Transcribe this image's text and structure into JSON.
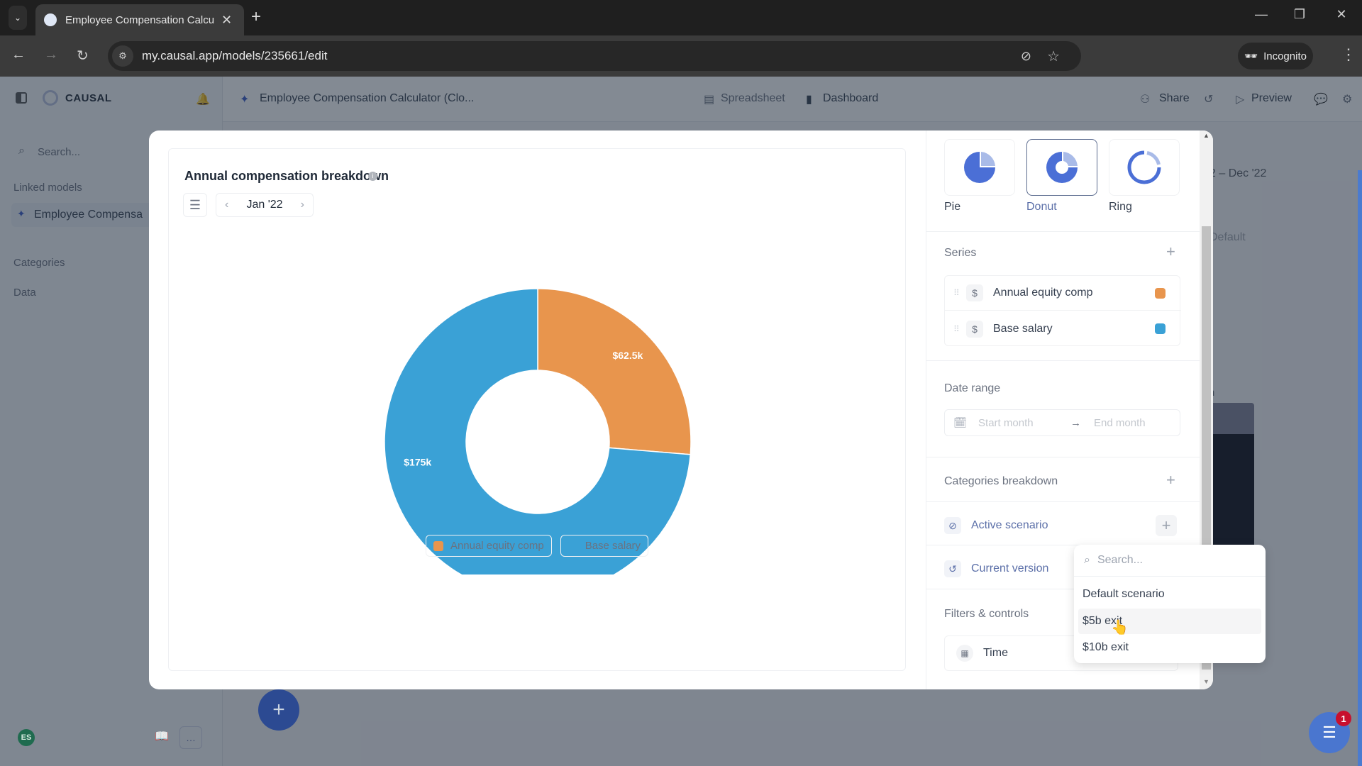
{
  "browser": {
    "tab_title": "Employee Compensation Calcul",
    "url": "my.causal.app/models/235661/edit",
    "incognito_label": "Incognito"
  },
  "app": {
    "brand": "CAUSAL",
    "sidebar": {
      "search_placeholder": "Search...",
      "linked_models_label": "Linked models",
      "linked_model": "Employee Compensa",
      "categories_label": "Categories",
      "data_label": "Data",
      "avatar_initials": "ES"
    },
    "header": {
      "model_title": "Employee Compensation Calculator (Clo...",
      "tabs": [
        {
          "label": "Spreadsheet"
        },
        {
          "label": "Dashboard"
        }
      ],
      "share_label": "Share",
      "preview_label": "Preview"
    },
    "background": {
      "date_range": "2 – Dec '22",
      "scenario": "Default",
      "partial_heading": "n"
    },
    "support_badge": "1"
  },
  "modal": {
    "chart_title": "Annual compensation breakdown",
    "period": "Jan '22",
    "chart_types": [
      {
        "label": "Pie",
        "selected": false
      },
      {
        "label": "Donut",
        "selected": true
      },
      {
        "label": "Ring",
        "selected": false
      }
    ],
    "series_title": "Series",
    "series": [
      {
        "name": "Annual equity comp",
        "color": "#e8954d"
      },
      {
        "name": "Base salary",
        "color": "#3aa1d6"
      }
    ],
    "date_range_title": "Date range",
    "start_placeholder": "Start month",
    "end_placeholder": "End month",
    "categories_breakdown_title": "Categories breakdown",
    "active_scenario_label": "Active scenario",
    "current_version_label": "Current version",
    "filters_title": "Filters & controls",
    "time_label": "Time"
  },
  "dropdown": {
    "search_placeholder": "Search...",
    "items": [
      {
        "label": "Default scenario",
        "hovered": false
      },
      {
        "label": "$5b exit",
        "hovered": true
      },
      {
        "label": "$10b exit",
        "hovered": false
      }
    ]
  },
  "chart_data": {
    "type": "pie",
    "variant": "donut",
    "title": "Annual compensation breakdown",
    "period": "Jan '22",
    "categories": [
      "Annual equity comp",
      "Base salary"
    ],
    "values": [
      62500,
      175000
    ],
    "labels": [
      "$62.5k",
      "$175k"
    ],
    "colors": [
      "#e8954d",
      "#3aa1d6"
    ],
    "legend": "bottom"
  }
}
